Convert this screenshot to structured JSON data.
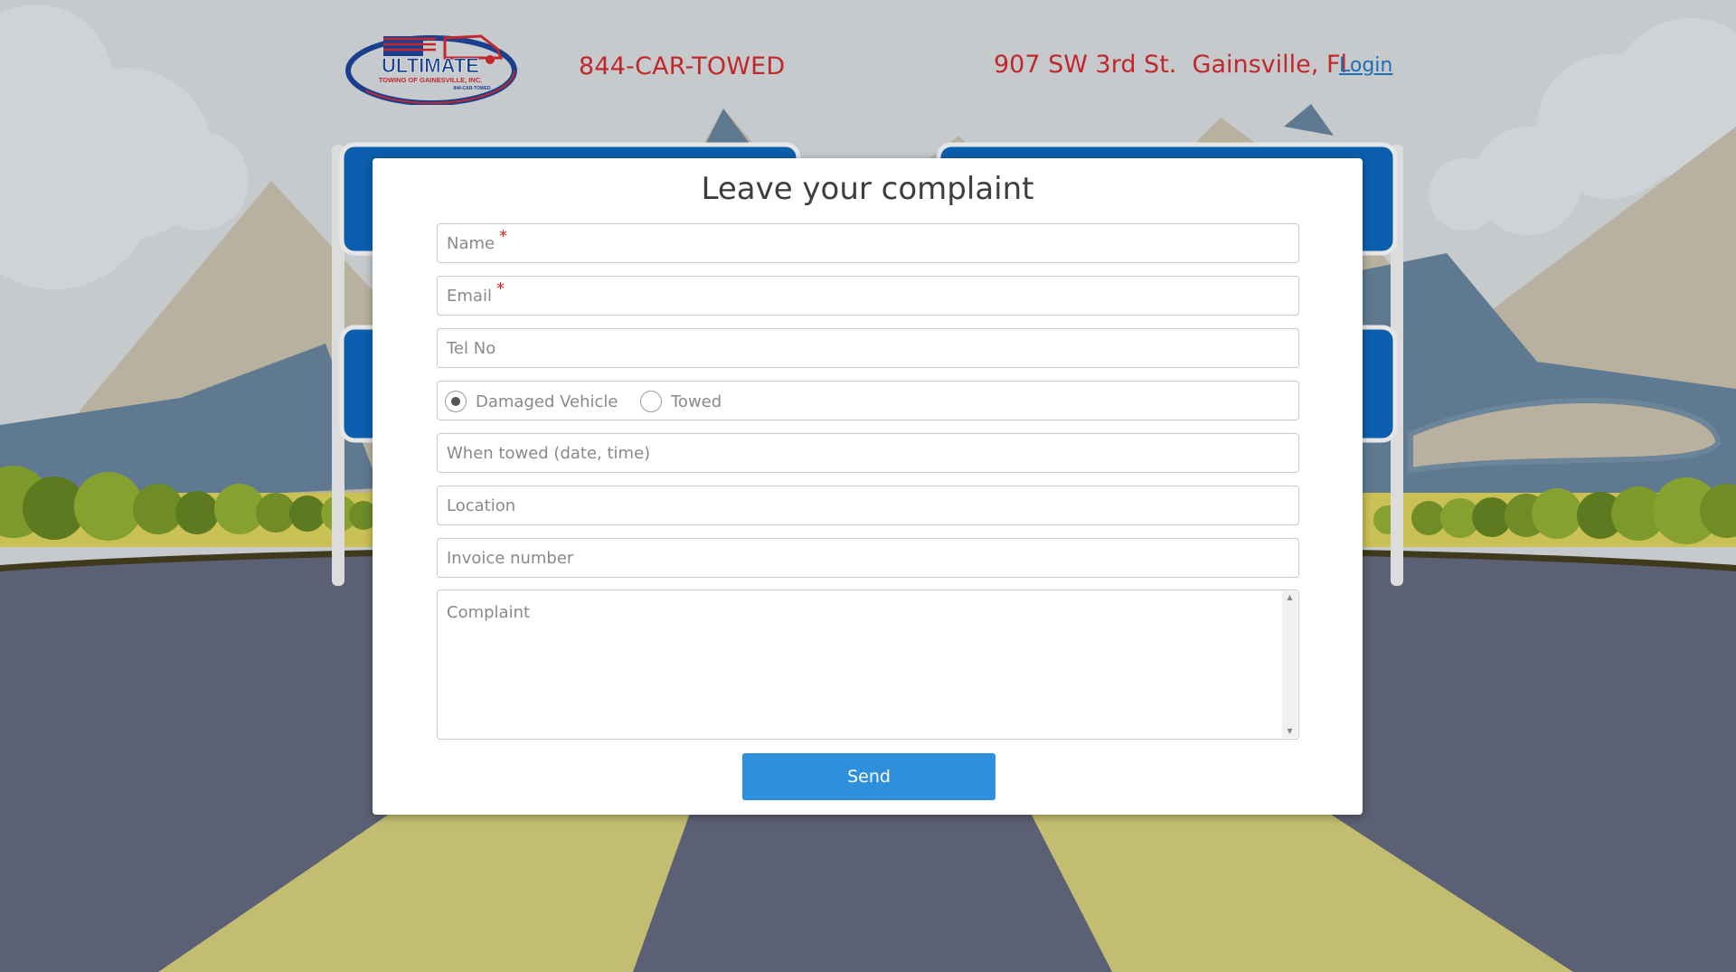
{
  "header": {
    "logo_name": "ULTIMATE",
    "logo_sub": "TOWING OF GAINESVILLE, INC.",
    "logo_phone": "844-CAR-TOWED",
    "phone": "844-CAR-TOWED",
    "address": "907 SW 3rd St.  Gainsville, Fl",
    "login": "Login"
  },
  "form": {
    "title": "Leave your complaint",
    "name_placeholder": "Name",
    "email_placeholder": "Email",
    "required_mark": "*",
    "tel_placeholder": "Tel No",
    "radio_damaged": "Damaged Vehicle",
    "radio_towed": "Towed",
    "radio_selected": "Damaged Vehicle",
    "when_towed_placeholder": "When towed (date, time)",
    "location_placeholder": "Location",
    "invoice_placeholder": "Invoice number",
    "complaint_placeholder": "Complaint",
    "send_label": "Send"
  },
  "colors": {
    "accent": "#2e8fdc",
    "brand_red": "#c0282c",
    "link": "#1f6fb5",
    "road": "#5c6074",
    "road_stripe": "#c2bd70",
    "sign_blue": "#0b5fae"
  }
}
